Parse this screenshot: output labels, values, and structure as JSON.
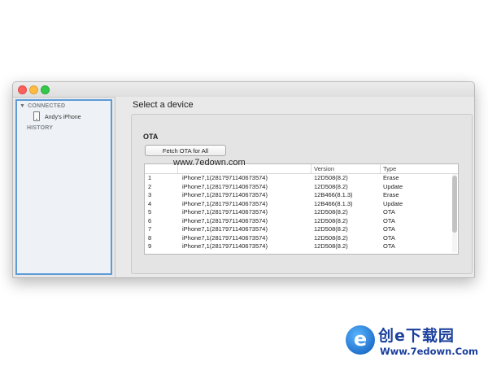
{
  "sidebar": {
    "connected_label": "CONNECTED",
    "device_name": "Andy's iPhone",
    "history_label": "HISTORY"
  },
  "main": {
    "title": "Select a device",
    "section_label": "OTA",
    "fetch_button": "Fetch OTA for All"
  },
  "table": {
    "columns": [
      "",
      "",
      "Version",
      "Type"
    ],
    "rows": [
      {
        "num": "1",
        "device": "iPhone7,1(2817971140673574)",
        "version": "12D508(8.2)",
        "type": "Erase"
      },
      {
        "num": "2",
        "device": "iPhone7,1(2817971140673574)",
        "version": "12D508(8.2)",
        "type": "Update"
      },
      {
        "num": "3",
        "device": "iPhone7,1(2817971140673574)",
        "version": "12B466(8.1.3)",
        "type": "Erase"
      },
      {
        "num": "4",
        "device": "iPhone7,1(2817971140673574)",
        "version": "12B466(8.1.3)",
        "type": "Update"
      },
      {
        "num": "5",
        "device": "iPhone7,1(2817971140673574)",
        "version": "12D508(8.2)",
        "type": "OTA"
      },
      {
        "num": "6",
        "device": "iPhone7,1(2817971140673574)",
        "version": "12D508(8.2)",
        "type": "OTA"
      },
      {
        "num": "7",
        "device": "iPhone7,1(2817971140673574)",
        "version": "12D508(8.2)",
        "type": "OTA"
      },
      {
        "num": "8",
        "device": "iPhone7,1(2817971140673574)",
        "version": "12D508(8.2)",
        "type": "OTA"
      },
      {
        "num": "9",
        "device": "iPhone7,1(2817971140673574)",
        "version": "12D508(8.2)",
        "type": "OTA"
      }
    ]
  },
  "watermark": {
    "overlay_text": "www.7edown.com",
    "logo_letter": "e",
    "logo_cn": "创e下载园",
    "logo_url": "Www.7edown.Com"
  },
  "colors": {
    "sidebar_selection_border": "#5e9bd7",
    "traffic_red": "#fc605c",
    "traffic_yellow": "#fdbc40",
    "traffic_green": "#34c84a"
  }
}
